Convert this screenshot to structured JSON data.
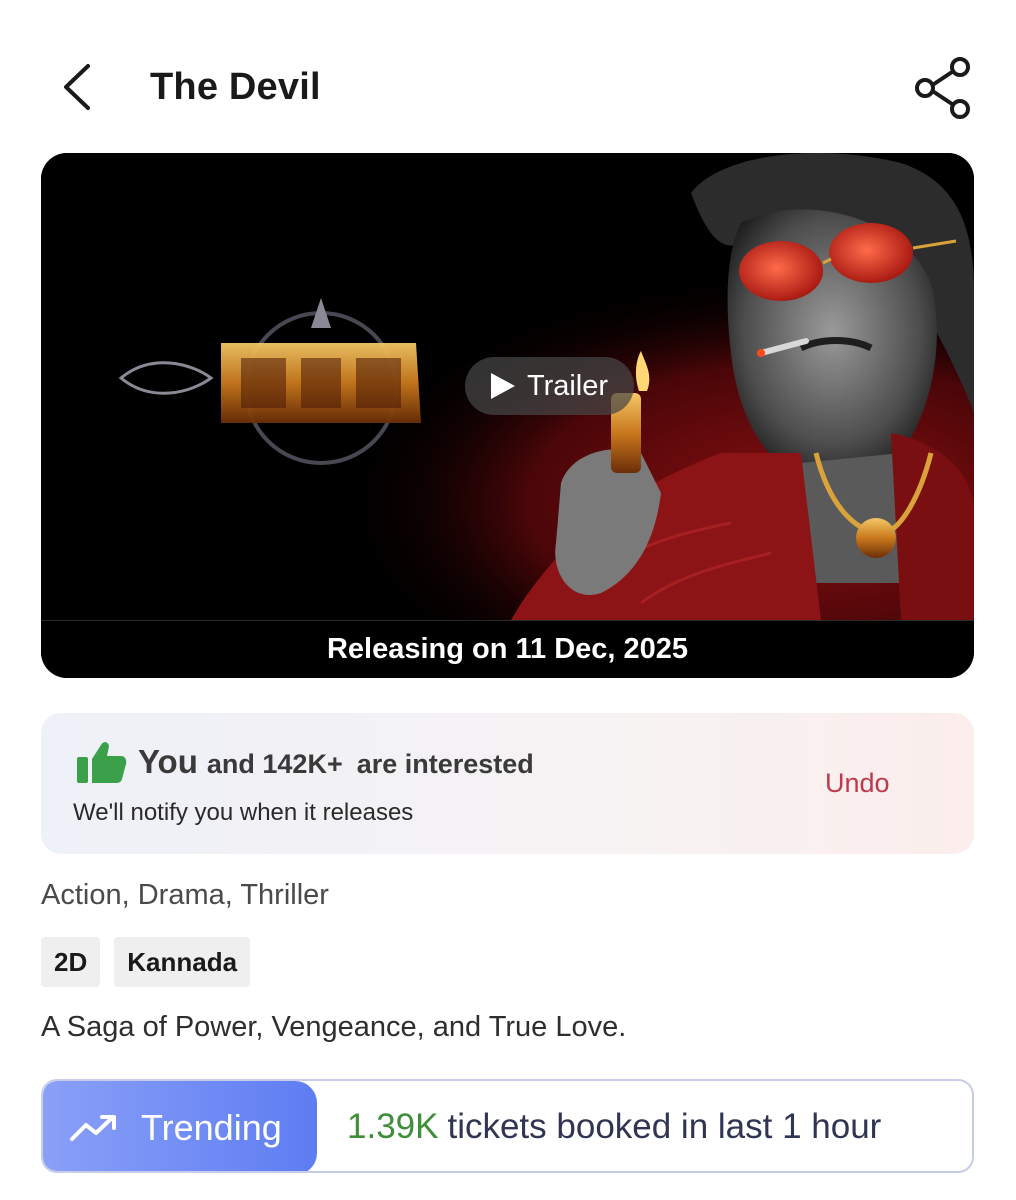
{
  "header": {
    "title": "The Devil"
  },
  "poster": {
    "trailer_label": "Trailer",
    "release_text": "Releasing on 11 Dec, 2025"
  },
  "interest": {
    "you": "You",
    "count_text": "and 142K+",
    "suffix": "are interested",
    "notify": "We'll notify you when it releases",
    "undo_label": "Undo"
  },
  "details": {
    "genres": "Action, Drama, Thriller",
    "tags": [
      "2D",
      "Kannada"
    ],
    "tagline": "A Saga of Power, Vengeance, and True Love."
  },
  "trending": {
    "label": "Trending",
    "count": "1.39K",
    "text": "tickets booked in last 1 hour"
  },
  "colors": {
    "undo": "#c0394b",
    "trending_badge": "#6b87f4",
    "trending_count": "#3f8f3a",
    "thumb": "#3aa04a"
  },
  "icons": [
    "back-arrow-icon",
    "share-icon",
    "play-icon",
    "thumbs-up-icon",
    "trending-up-icon"
  ]
}
